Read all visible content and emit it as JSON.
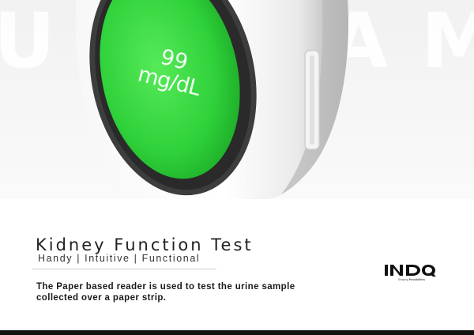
{
  "hero": {
    "background_word": "URISAM",
    "screen": {
      "value": "99",
      "unit": "mg/dL",
      "color": "#2fd13a"
    }
  },
  "content": {
    "title": "Kidney Function Test",
    "subtitle": "Handy | Intuitive | Functional",
    "description": "The Paper based reader is used to test the urine sample collected over a paper strip."
  },
  "logo": {
    "mark": "INDQ",
    "tagline_prefix": "Shaping ",
    "tagline_emphasis": "Possibilities"
  }
}
